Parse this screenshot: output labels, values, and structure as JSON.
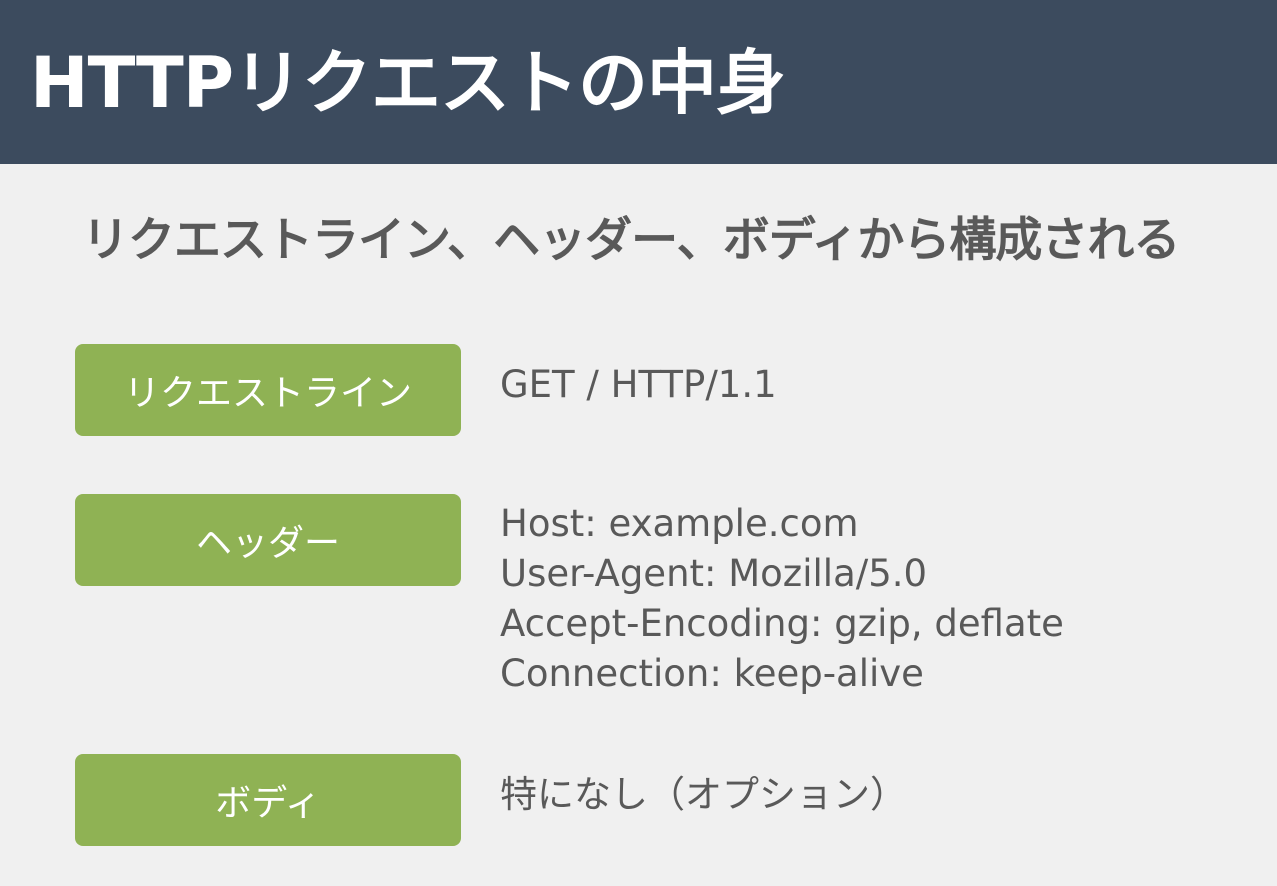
{
  "header": {
    "title": "HTTPリクエストの中身"
  },
  "subtitle": "リクエストライン、ヘッダー、ボディから構成される",
  "sections": [
    {
      "label": "リクエストライン",
      "lines": [
        "GET / HTTP/1.1"
      ]
    },
    {
      "label": "ヘッダー",
      "lines": [
        "Host: example.com",
        "User-Agent: Mozilla/5.0",
        "Accept-Encoding: gzip, deflate",
        "Connection: keep-alive"
      ]
    },
    {
      "label": "ボディ",
      "lines": [
        "特になし（オプション）"
      ]
    }
  ],
  "colors": {
    "header_bg": "#3c4b5e",
    "page_bg": "#f0f0f0",
    "badge_bg": "#8fb254",
    "text": "#595959"
  }
}
